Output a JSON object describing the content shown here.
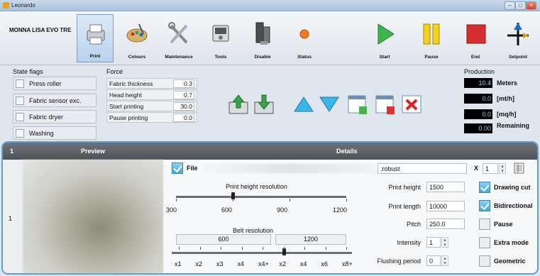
{
  "window": {
    "title": "Leonardo"
  },
  "toolbar": {
    "machine_name": "MONNA LISA EVO TRE",
    "left_buttons": [
      {
        "label": "Print",
        "icon": "printer-icon"
      },
      {
        "label": "Colours",
        "icon": "palette-icon"
      },
      {
        "label": "Maintenance",
        "icon": "tools-icon"
      },
      {
        "label": "Tools",
        "icon": "toolbox-icon"
      },
      {
        "label": "Disable",
        "icon": "ink-bottles-icon"
      },
      {
        "label": "Status",
        "icon": "status-dot-icon"
      }
    ],
    "right_buttons": [
      {
        "label": "Start",
        "icon": "play-icon"
      },
      {
        "label": "Pause",
        "icon": "pause-icon"
      },
      {
        "label": "End",
        "icon": "stop-icon"
      },
      {
        "label": "Setpoint",
        "icon": "setpoint-icon"
      }
    ]
  },
  "state_flags": {
    "title": "State flags",
    "items": [
      "Press roller",
      "Fabric sensor exc.",
      "Fabric dryer",
      "Washing"
    ]
  },
  "force": {
    "title": "Force",
    "rows": [
      {
        "label": "Fabric thickness",
        "value": "0.3"
      },
      {
        "label": "Head height",
        "value": "0.7"
      },
      {
        "label": "Start printing",
        "value": "30.0"
      },
      {
        "label": "Pause printing",
        "value": "0.0"
      }
    ]
  },
  "production": {
    "title": "Production",
    "rows": [
      {
        "value": "10.4",
        "unit": "Meters"
      },
      {
        "value": "0.0",
        "unit": "[mt/h]"
      },
      {
        "value": "0.0",
        "unit": "[mq/h]"
      },
      {
        "value": "0.00",
        "unit": "Remaining"
      }
    ]
  },
  "details": {
    "row_number": "1",
    "header_index": "1",
    "preview_label": "Preview",
    "details_label": "Details",
    "file_label": "File",
    "file_name": ".robust",
    "copies_x": "X",
    "copies": "1",
    "print_height_resolution_label": "Print height resolution",
    "resolution_ticks": [
      "300",
      "600",
      "900",
      "1200"
    ],
    "resolution_value": 600,
    "belt_resolution_label": "Belt resolution",
    "belt_boxes": [
      "600",
      "1200"
    ],
    "belt_ticks": [
      "x1",
      "x2",
      "x3",
      "x4",
      "x4+",
      "x2",
      "x4",
      "x6",
      "x8+"
    ],
    "belt_value_index": 5,
    "print_height_label": "Print height",
    "print_height": "1500",
    "print_length_label": "Print length",
    "print_length": "10000",
    "pitch_label": "Pitch",
    "pitch": "250.0",
    "intensity_label": "Intensity",
    "intensity": "1",
    "flushing_label": "Flushing period",
    "flushing": "0",
    "options": [
      {
        "label": "Drawing cut",
        "checked": true
      },
      {
        "label": "Bidirectional",
        "checked": true
      },
      {
        "label": "Pause",
        "checked": false
      },
      {
        "label": "Extra mode",
        "checked": false
      },
      {
        "label": "Geometric",
        "checked": false
      }
    ]
  }
}
